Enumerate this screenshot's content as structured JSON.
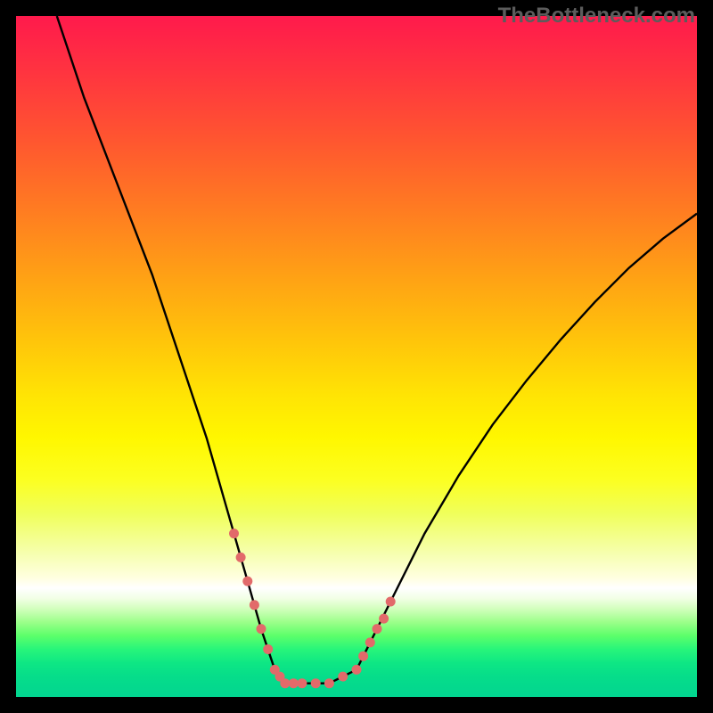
{
  "watermark": "TheBottleneck.com",
  "chart_data": {
    "type": "line",
    "title": "",
    "xlabel": "",
    "ylabel": "",
    "xlim": [
      0,
      100
    ],
    "ylim": [
      0,
      100
    ],
    "grid": false,
    "series": [
      {
        "name": "black-curve",
        "color": "#000000",
        "x": [
          6,
          10,
          15,
          20,
          25,
          28,
          30,
          32,
          34,
          36,
          38,
          39.5,
          42,
          46,
          50,
          52,
          55,
          60,
          65,
          70,
          75,
          80,
          85,
          90,
          95,
          100
        ],
        "y": [
          100,
          88,
          75,
          62,
          47,
          38,
          31,
          24,
          17,
          10,
          4,
          2,
          2,
          2,
          4,
          8,
          14,
          24,
          32.5,
          40,
          46.5,
          52.5,
          58,
          63,
          67.3,
          71
        ]
      },
      {
        "name": "pink-dotted-valley",
        "color": "#e26a6a",
        "style": "dotted",
        "x": [
          32,
          34,
          36,
          38,
          39.5,
          42,
          46,
          50,
          52,
          54,
          55
        ],
        "y": [
          24,
          17,
          10,
          4,
          2,
          2,
          2,
          4,
          8,
          11.5,
          14
        ]
      }
    ]
  }
}
